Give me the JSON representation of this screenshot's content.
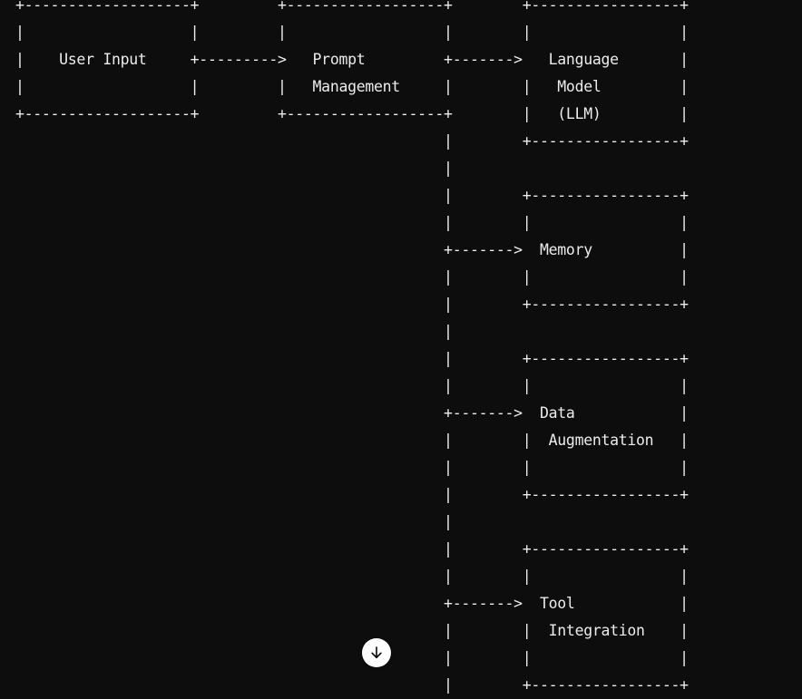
{
  "diagram": {
    "lines": [
      "+-------------------+         +------------------+        +-----------------+",
      "|                   |         |                  |        |                 |",
      "|    User Input     +--------->   Prompt         +------->   Language       |",
      "|                   |         |   Management     |        |   Model         |",
      "+-------------------+         +------------------+        |   (LLM)         |",
      "                                                 |        +-----------------+",
      "                                                 |",
      "                                                 |        +-----------------+",
      "                                                 |        |                 |",
      "                                                 +------->  Memory          |",
      "                                                 |        |                 |",
      "                                                 |        +-----------------+",
      "                                                 |",
      "                                                 |        +-----------------+",
      "                                                 |        |                 |",
      "                                                 +------->  Data            |",
      "                                                 |        |  Augmentation   |",
      "                                                 |        |                 |",
      "                                                 |        +-----------------+",
      "                                                 |",
      "                                                 |        +-----------------+",
      "                                                 |        |                 |",
      "                                                 +------->  Tool            |",
      "                                                 |        |  Integration    |",
      "                                                 |        |                 |",
      "                                                 |        +-----------------+"
    ]
  },
  "scroll_button": {
    "icon": "arrow-down-icon"
  },
  "colors": {
    "background": "#0d0d0d",
    "text": "#ececec",
    "button_bg": "#ffffff",
    "button_icon": "#0d0d0d"
  }
}
